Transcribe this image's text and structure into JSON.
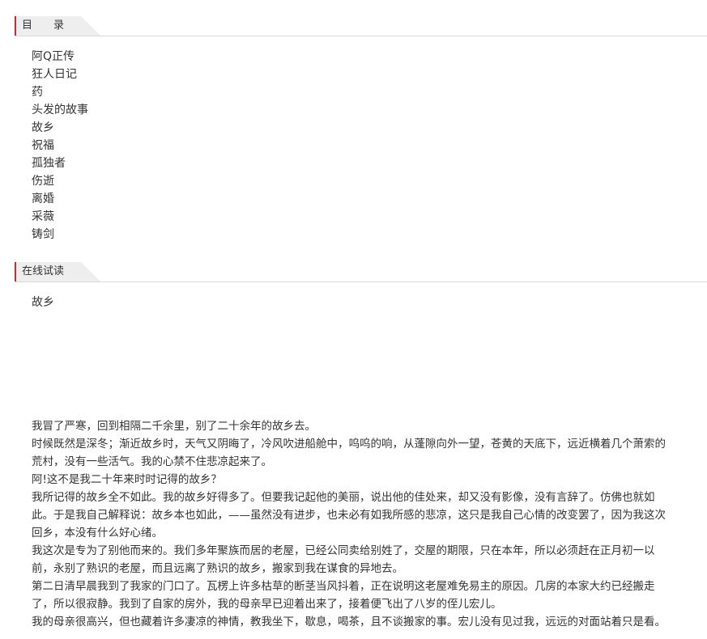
{
  "toc": {
    "title": "目　　录",
    "items": [
      "阿Q正传",
      "狂人日记",
      "药",
      "头发的故事",
      "故乡",
      "祝福",
      "孤独者",
      "伤逝",
      "离婚",
      "采薇",
      "铸剑"
    ]
  },
  "reading": {
    "title": "在线试读",
    "chapter": "故乡",
    "lines": [
      "我冒了严寒，回到相隔二千余里，别了二十余年的故乡去。",
      "时候既然是深冬；渐近故乡时，天气又阴晦了，冷风吹进船舱中，呜呜的响，从蓬隙向外一望，苍黄的天底下，远近横着几个萧索的",
      "荒村，没有一些活气。我的心禁不住悲凉起来了。",
      "阿!这不是我二十年来时时记得的故乡？",
      "我所记得的故乡全不如此。我的故乡好得多了。但要我记起他的美丽，说出他的佳处来，却又没有影像，没有言辞了。仿佛也就如",
      "此。于是我自己解释说：故乡本也如此，——虽然没有进步，也未必有如我所感的悲凉，这只是我自己心情的改变罢了，因为我这次",
      "回乡，本没有什么好心绪。",
      "我这次是专为了别他而来的。我们多年聚族而居的老屋，已经公同卖给别姓了，交屋的期限，只在本年，所以必须赶在正月初一以",
      "前，永别了熟识的老屋，而且远离了熟识的故乡，搬家到我在谋食的异地去。",
      "第二日清早晨我到了我家的门口了。瓦楞上许多枯草的断茎当风抖着，正在说明这老屋难免易主的原因。几房的本家大约已经搬走",
      "了，所以很寂静。我到了自家的房外，我的母亲早已迎着出来了，接着便飞出了八岁的侄儿宏儿。",
      "我的母亲很高兴，但也藏着许多凄凉的神情，教我坐下，歇息，喝茶，且不谈搬家的事。宏儿没有见过我，远远的对面站着只是看。"
    ]
  },
  "colors": {
    "accent": "#d8262a",
    "tab_bg": "#eeeeee",
    "text": "#333333"
  }
}
